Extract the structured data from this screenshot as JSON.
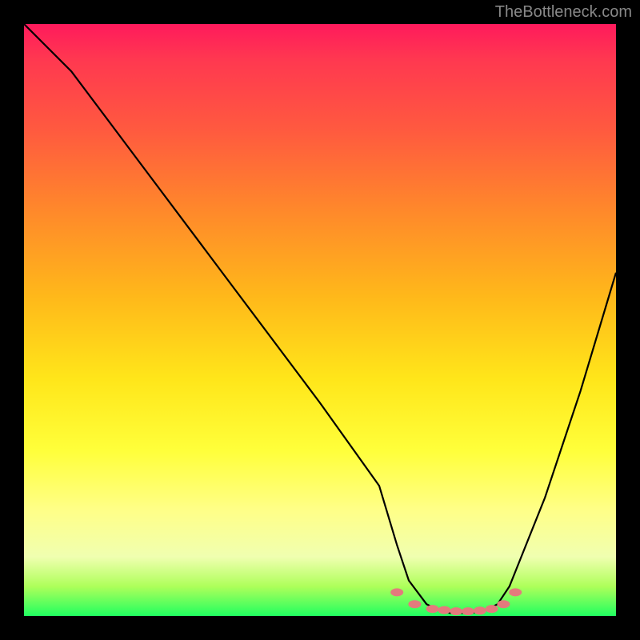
{
  "attribution": "TheBottleneck.com",
  "chart_data": {
    "type": "line",
    "title": "",
    "xlabel": "",
    "ylabel": "",
    "xlim": [
      0,
      100
    ],
    "ylim": [
      0,
      100
    ],
    "series": [
      {
        "name": "bottleneck-curve",
        "x": [
          0,
          8,
          20,
          35,
          50,
          60,
          63,
          65,
          68,
          70,
          72,
          74,
          76,
          78,
          80,
          82,
          84,
          88,
          94,
          100
        ],
        "y": [
          100,
          92,
          76,
          56,
          36,
          22,
          12,
          6,
          2,
          1,
          0.5,
          0.5,
          0.6,
          1,
          2,
          5,
          10,
          20,
          38,
          58
        ]
      }
    ],
    "markers": {
      "name": "optimal-range",
      "x": [
        63,
        66,
        69,
        71,
        73,
        75,
        77,
        79,
        81,
        83
      ],
      "y": [
        4,
        2,
        1.2,
        1,
        0.8,
        0.8,
        0.9,
        1.2,
        2,
        4
      ]
    },
    "gradient": {
      "top_color": "#ff1a5c",
      "mid_color": "#ffe61a",
      "bottom_color": "#20ff60"
    }
  }
}
